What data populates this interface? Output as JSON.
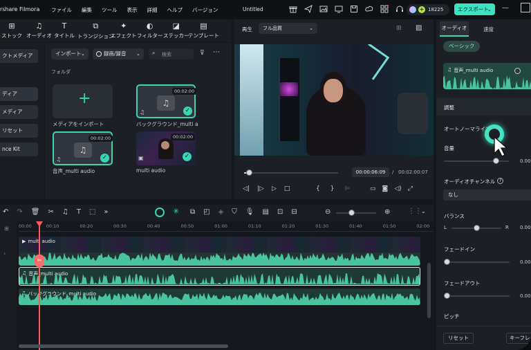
{
  "titlebar": {
    "app_name": "rshare Filmora",
    "menu": [
      "ファイル",
      "編集",
      "ツール",
      "表示",
      "詳細",
      "ヘルプ",
      "バージョン"
    ],
    "project_name": "Untitled",
    "credits": "18225",
    "export_label": "エクスポート"
  },
  "toolbar": {
    "items": [
      "ストック",
      "オーディオ",
      "タイトル",
      "トランジション",
      "エフェクト",
      "フィルター",
      "ステッカー",
      "テンプレート"
    ]
  },
  "media_sidebar": {
    "items": [
      "クトメディア",
      "",
      "ディア",
      "メディア",
      "リセット",
      "nce Kit"
    ]
  },
  "media_panel": {
    "import_button": "インポート",
    "record_button": "録画/録音",
    "search_placeholder": "検索",
    "folder_label": "フォルダ",
    "import_card_label": "メディアをインポート",
    "clips": [
      {
        "name": "バックグラウンド_multi au...",
        "duration": "00:02:00"
      },
      {
        "name": "音声_multi audio",
        "duration": "00:02:00"
      },
      {
        "name": "multi audio",
        "duration": "00:02:00"
      }
    ]
  },
  "preview": {
    "play_label": "再生",
    "quality": "フル品質",
    "current_time": "00:00:06:09",
    "separator": "/",
    "total_time": "00:02:00:07",
    "progress": 0.05
  },
  "timeline": {
    "ruler": [
      "00:00",
      "00:10",
      "00:20",
      "00:30",
      "00:40",
      "00:50",
      "01:00",
      "01:10",
      "01:20",
      "01:30",
      "01:40",
      "01:50",
      "02:00"
    ],
    "tracks": {
      "video": "multi audio",
      "audio1": "音声_multi audio",
      "audio2": "バックグラウンド_multi audio"
    }
  },
  "right_panel": {
    "tabs": [
      "オーディオ",
      "速度"
    ],
    "basic_chip": "ベーシック",
    "clip_name": "音声_multi audio",
    "section_adjust": "調整",
    "autonormalize": "オートノーマライズ",
    "volume_label": "音量",
    "volume_value": "0.00",
    "channel_label": "オーディオチャンネル",
    "channel_value": "なし",
    "balance_label": "バランス",
    "balance_left": "L",
    "balance_right": "R",
    "balance_value": "0.00",
    "fadein_label": "フェードイン",
    "fadein_value": "0.00",
    "fadeout_label": "フェードアウト",
    "fadeout_value": "0.00",
    "pitch_label": "ピッチ",
    "reset_button": "リセット",
    "keyframe_button": "キーフレー"
  },
  "colors": {
    "accent": "#3ad6b4",
    "audio_wave": "#49c4a0",
    "playhead": "#ff5a5a"
  }
}
